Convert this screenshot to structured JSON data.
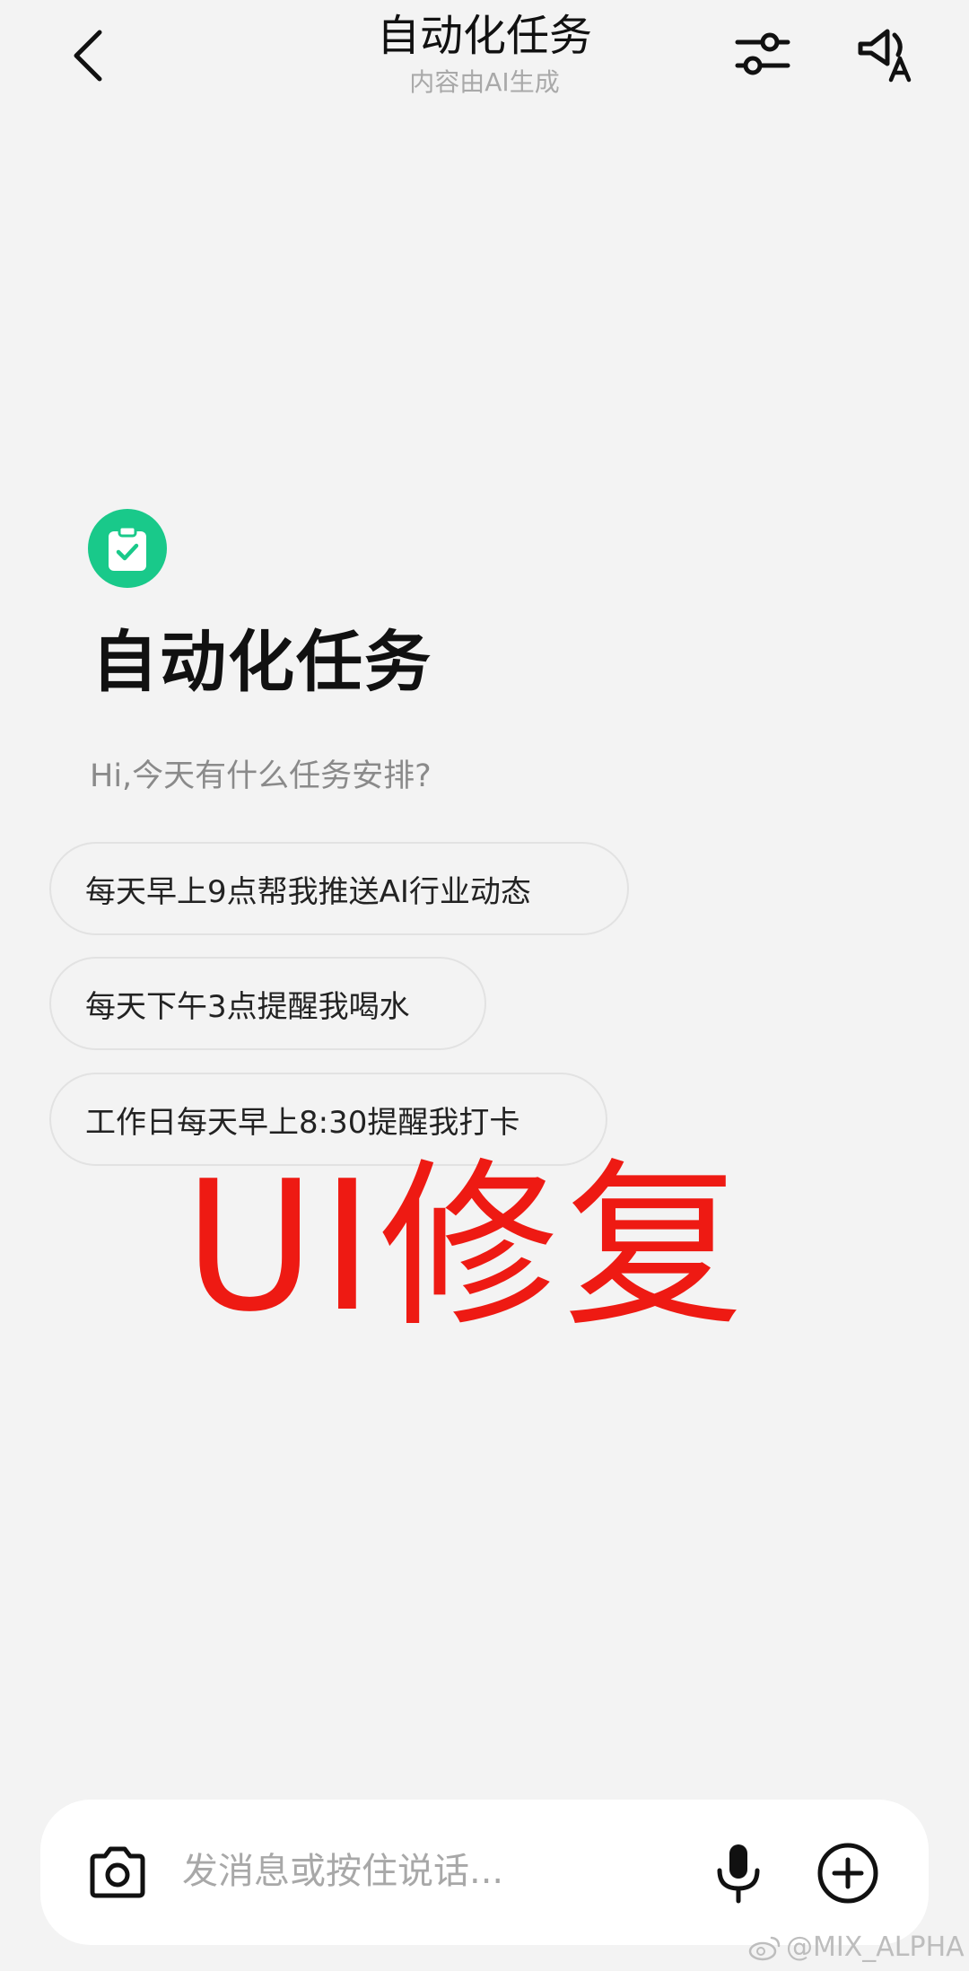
{
  "header": {
    "title": "自动化任务",
    "subtitle": "内容由AI生成"
  },
  "intro": {
    "app_icon": "clipboard-check-icon",
    "icon_color": "#19c98a",
    "title": "自动化任务",
    "greeting": "Hi,今天有什么任务安排?"
  },
  "suggestions": [
    {
      "label": "每天早上9点帮我推送AI行业动态"
    },
    {
      "label": "每天下午3点提醒我喝水"
    },
    {
      "label": "工作日每天早上8:30提醒我打卡"
    }
  ],
  "overlay": {
    "text": "UI修复",
    "color": "#ee1a13"
  },
  "input_bar": {
    "placeholder": "发消息或按住说话...",
    "value": ""
  },
  "watermark": {
    "text": "@MIX_ALPHA"
  }
}
